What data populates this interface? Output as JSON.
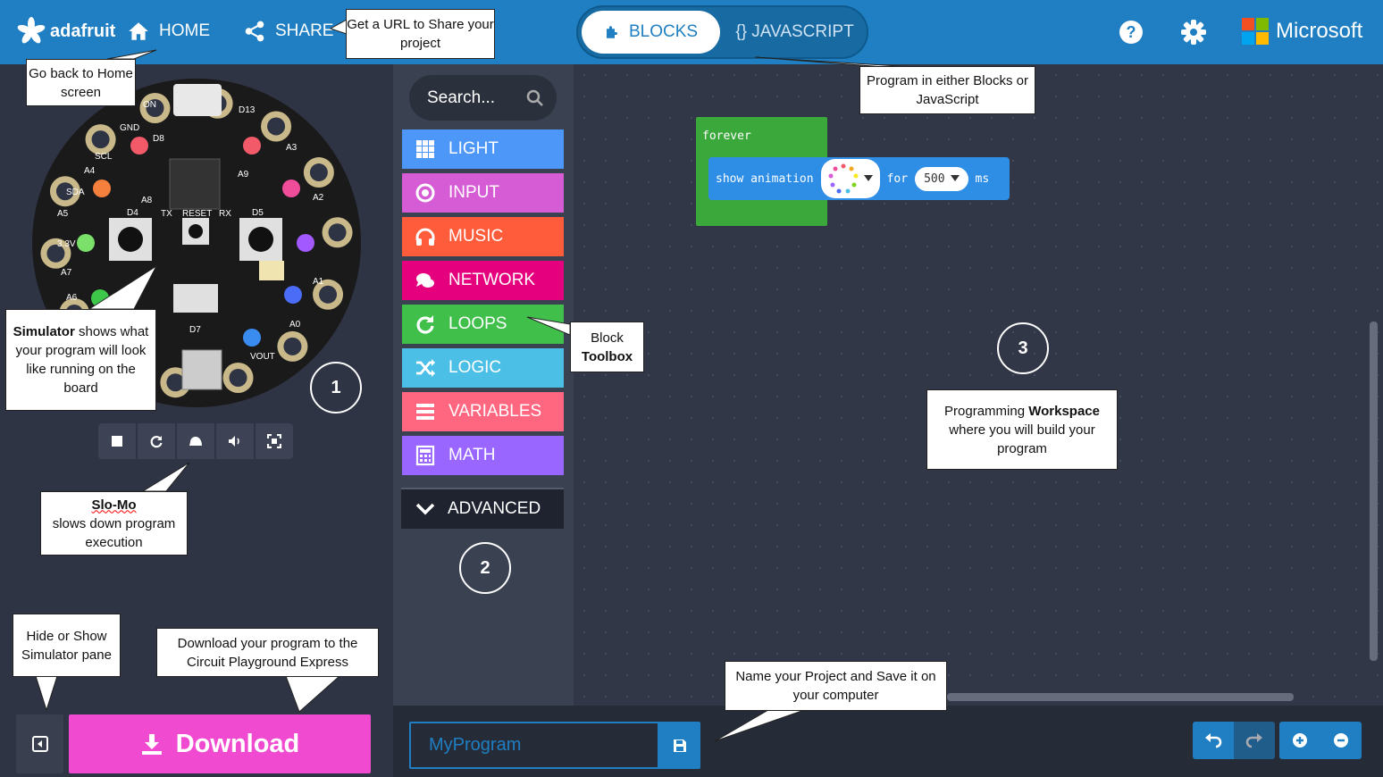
{
  "header": {
    "logo_text": "adafruit",
    "home_label": "HOME",
    "share_label": "SHARE",
    "blocks_label": "BLOCKS",
    "javascript_label": "{} JAVASCRIPT",
    "microsoft_label": "Microsoft",
    "colors": {
      "bar": "#1f7fc2"
    }
  },
  "toolbox": {
    "search_placeholder": "Search...",
    "categories": [
      {
        "label": "LIGHT",
        "color": "#4c97f8",
        "icon": "grid-icon"
      },
      {
        "label": "INPUT",
        "color": "#d65cd6",
        "icon": "radio-icon"
      },
      {
        "label": "MUSIC",
        "color": "#fe5c3b",
        "icon": "headphones-icon"
      },
      {
        "label": "NETWORK",
        "color": "#e5007e",
        "icon": "chat-icon"
      },
      {
        "label": "LOOPS",
        "color": "#40bf4a",
        "icon": "refresh-icon"
      },
      {
        "label": "LOGIC",
        "color": "#4cbfe6",
        "icon": "shuffle-icon"
      },
      {
        "label": "VARIABLES",
        "color": "#ff6680",
        "icon": "list-icon"
      },
      {
        "label": "MATH",
        "color": "#9966ff",
        "icon": "calculator-icon"
      }
    ],
    "advanced_label": "ADVANCED"
  },
  "workspace": {
    "forever_label": "forever",
    "show_animation_label": "show animation",
    "for_label": "for",
    "duration_value": "500",
    "ms_label": "ms"
  },
  "bottom": {
    "download_label": "Download",
    "project_name": "MyProgram"
  },
  "callouts": {
    "share": "Get a URL to Share your project",
    "home": "Go back to Home screen",
    "mode": "Program in either Blocks or JavaScript",
    "simulator_bold": "Simulator",
    "simulator_rest": " shows what your program will look like running on the board",
    "toolbox_line1": "Block",
    "toolbox_line2": "Toolbox",
    "workspace_pre": "Programming ",
    "workspace_bold": "Workspace",
    "workspace_post": " where you will build your program",
    "slomo_bold": "Slo-Mo",
    "slomo_rest": "slows down program execution",
    "hide": "Hide or Show Simulator pane",
    "download": "Download your program to the Circuit Playground Express",
    "save": "Name your Project and Save it on your computer"
  },
  "numbers": {
    "n1": "1",
    "n2": "2",
    "n3": "3"
  },
  "board_labels": {
    "d8": "D8",
    "d13": "D13",
    "gnd": "GND",
    "a8": "A8",
    "a9": "A9",
    "d4": "D4",
    "tx": "TX",
    "reset": "RESET",
    "rx": "RX",
    "d5": "D5",
    "d7": "D7",
    "scl": "SCL",
    "sda": "SDA",
    "a3": "A3",
    "a2": "A2",
    "a1": "A1",
    "a0": "A0",
    "v33": "3.3V",
    "vout": "VOUT",
    "on": "ON",
    "a4": "A4",
    "a5": "A5",
    "a6": "A6",
    "a7": "A7"
  }
}
